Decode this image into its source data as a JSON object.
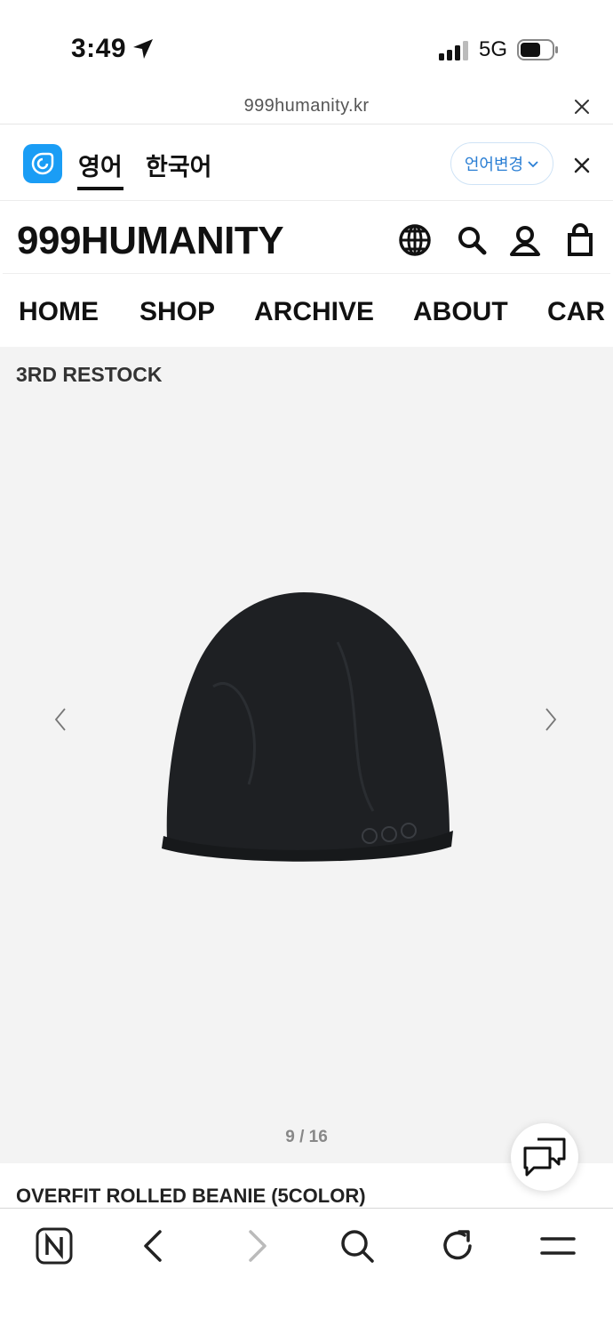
{
  "status_bar": {
    "time": "3:49",
    "network": "5G"
  },
  "browser": {
    "url": "999humanity.kr"
  },
  "translate_bar": {
    "tabs": [
      "영어",
      "한국어"
    ],
    "active_tab": "영어",
    "change_language_label": "언어변경"
  },
  "site": {
    "logo": "999HUMANITY",
    "nav": [
      "HOME",
      "SHOP",
      "ARCHIVE",
      "ABOUT",
      "CAR"
    ]
  },
  "product": {
    "badge": "3RD RESTOCK",
    "image_pager": "9 / 16",
    "title": "OVERFIT ROLLED BEANIE (5COLOR)"
  },
  "colors": {
    "papago_blue": "#1a9df5",
    "link_blue": "#2b7fd4",
    "product_bg": "#f3f3f3",
    "beanie": "#1e2023"
  }
}
